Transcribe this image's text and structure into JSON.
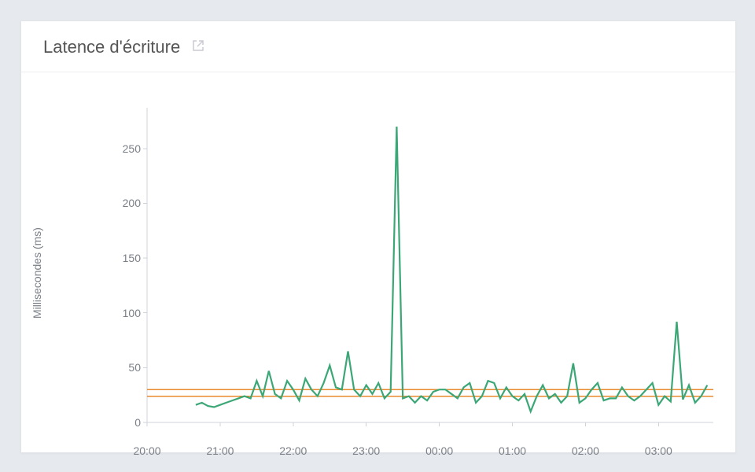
{
  "header": {
    "title": "Latence d'écriture",
    "external_link_icon": "external-link-icon"
  },
  "chart_data": {
    "type": "line",
    "title": "Latence d'écriture",
    "xlabel": "",
    "ylabel": "Millisecondes (ms)",
    "x_ticks": [
      "20:00",
      "21:00",
      "22:00",
      "23:00",
      "00:00",
      "01:00",
      "02:00",
      "03:00"
    ],
    "y_ticks": [
      0,
      50,
      100,
      150,
      200,
      250
    ],
    "xlim_minutes": [
      1200,
      1665
    ],
    "ylim": [
      0,
      280
    ],
    "series": [
      {
        "name": "Latence d'écriture",
        "color": "#3ba776",
        "x_minutes": [
          1240,
          1245,
          1250,
          1255,
          1260,
          1265,
          1270,
          1275,
          1280,
          1285,
          1290,
          1295,
          1300,
          1305,
          1310,
          1315,
          1320,
          1325,
          1330,
          1335,
          1340,
          1345,
          1350,
          1355,
          1360,
          1365,
          1370,
          1375,
          1380,
          1385,
          1390,
          1395,
          1400,
          1405,
          1410,
          1415,
          1420,
          1425,
          1430,
          1435,
          1440,
          1445,
          1450,
          1455,
          1460,
          1465,
          1470,
          1475,
          1480,
          1485,
          1490,
          1495,
          1500,
          1505,
          1510,
          1515,
          1520,
          1525,
          1530,
          1535,
          1540,
          1545,
          1550,
          1555,
          1560,
          1565,
          1570,
          1575,
          1580,
          1585,
          1590,
          1595,
          1600,
          1605,
          1610,
          1615,
          1620,
          1625,
          1630,
          1635,
          1640,
          1645,
          1650,
          1655,
          1660
        ],
        "values": [
          16,
          18,
          15,
          14,
          16,
          18,
          20,
          22,
          24,
          22,
          38,
          24,
          47,
          26,
          22,
          38,
          30,
          20,
          40,
          30,
          24,
          36,
          52,
          32,
          30,
          65,
          30,
          24,
          34,
          26,
          36,
          22,
          28,
          270,
          22,
          24,
          18,
          24,
          20,
          28,
          30,
          30,
          26,
          22,
          32,
          36,
          18,
          24,
          38,
          36,
          22,
          32,
          24,
          20,
          26,
          10,
          24,
          34,
          22,
          26,
          18,
          24,
          54,
          18,
          22,
          30,
          36,
          20,
          22,
          22,
          32,
          24,
          20,
          24,
          30,
          36,
          16,
          24,
          19,
          92,
          21,
          34,
          18,
          24,
          34
        ]
      }
    ],
    "reference_lines": [
      {
        "name": "seuil-haut",
        "value": 30,
        "color": "#e88a2c"
      },
      {
        "name": "seuil-bas",
        "value": 24,
        "color": "#e88a2c"
      }
    ]
  }
}
